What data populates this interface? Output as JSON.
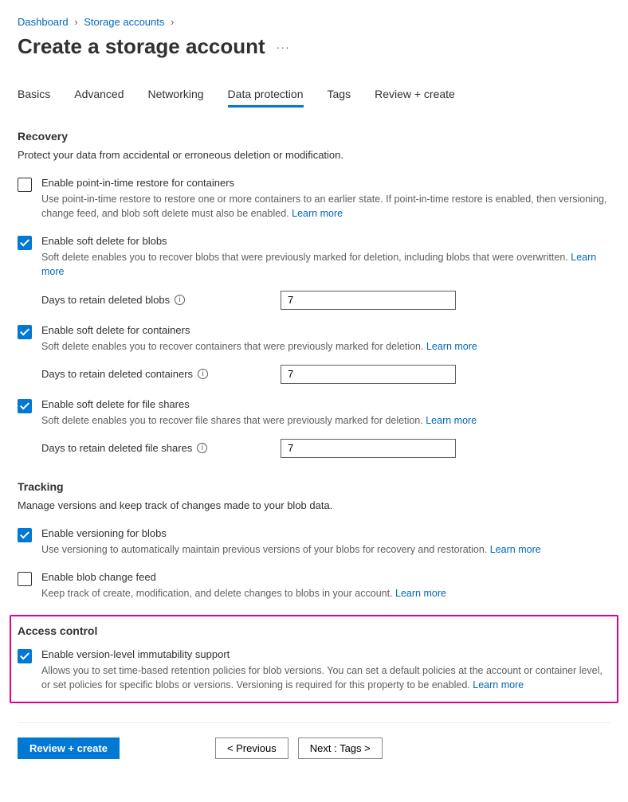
{
  "breadcrumb": {
    "dashboard": "Dashboard",
    "storage": "Storage accounts"
  },
  "page_title": "Create a storage account",
  "tabs": {
    "basics": "Basics",
    "advanced": "Advanced",
    "networking": "Networking",
    "data_protection": "Data protection",
    "tags": "Tags",
    "review": "Review + create"
  },
  "recovery": {
    "title": "Recovery",
    "desc": "Protect your data from accidental or erroneous deletion or modification.",
    "pitr_label": "Enable point-in-time restore for containers",
    "pitr_help": "Use point-in-time restore to restore one or more containers to an earlier state. If point-in-time restore is enabled, then versioning, change feed, and blob soft delete must also be enabled.",
    "sd_blobs_label": "Enable soft delete for blobs",
    "sd_blobs_help": "Soft delete enables you to recover blobs that were previously marked for deletion, including blobs that were overwritten.",
    "sd_blobs_days_label": "Days to retain deleted blobs",
    "sd_blobs_days_value": "7",
    "sd_containers_label": "Enable soft delete for containers",
    "sd_containers_help": "Soft delete enables you to recover containers that were previously marked for deletion.",
    "sd_containers_days_label": "Days to retain deleted containers",
    "sd_containers_days_value": "7",
    "sd_files_label": "Enable soft delete for file shares",
    "sd_files_help": "Soft delete enables you to recover file shares that were previously marked for deletion.",
    "sd_files_days_label": "Days to retain deleted file shares",
    "sd_files_days_value": "7"
  },
  "tracking": {
    "title": "Tracking",
    "desc": "Manage versions and keep track of changes made to your blob data.",
    "versioning_label": "Enable versioning for blobs",
    "versioning_help": "Use versioning to automatically maintain previous versions of your blobs for recovery and restoration.",
    "changefeed_label": "Enable blob change feed",
    "changefeed_help": "Keep track of create, modification, and delete changes to blobs in your account."
  },
  "access": {
    "title": "Access control",
    "immutability_label": "Enable version-level immutability support",
    "immutability_help": "Allows you to set time-based retention policies for blob versions. You can set a default policies at the account or container level, or set policies for specific blobs or versions. Versioning is required for this property to be enabled."
  },
  "learn_more": "Learn more",
  "footer": {
    "review": "Review + create",
    "previous": "< Previous",
    "next": "Next : Tags >"
  }
}
